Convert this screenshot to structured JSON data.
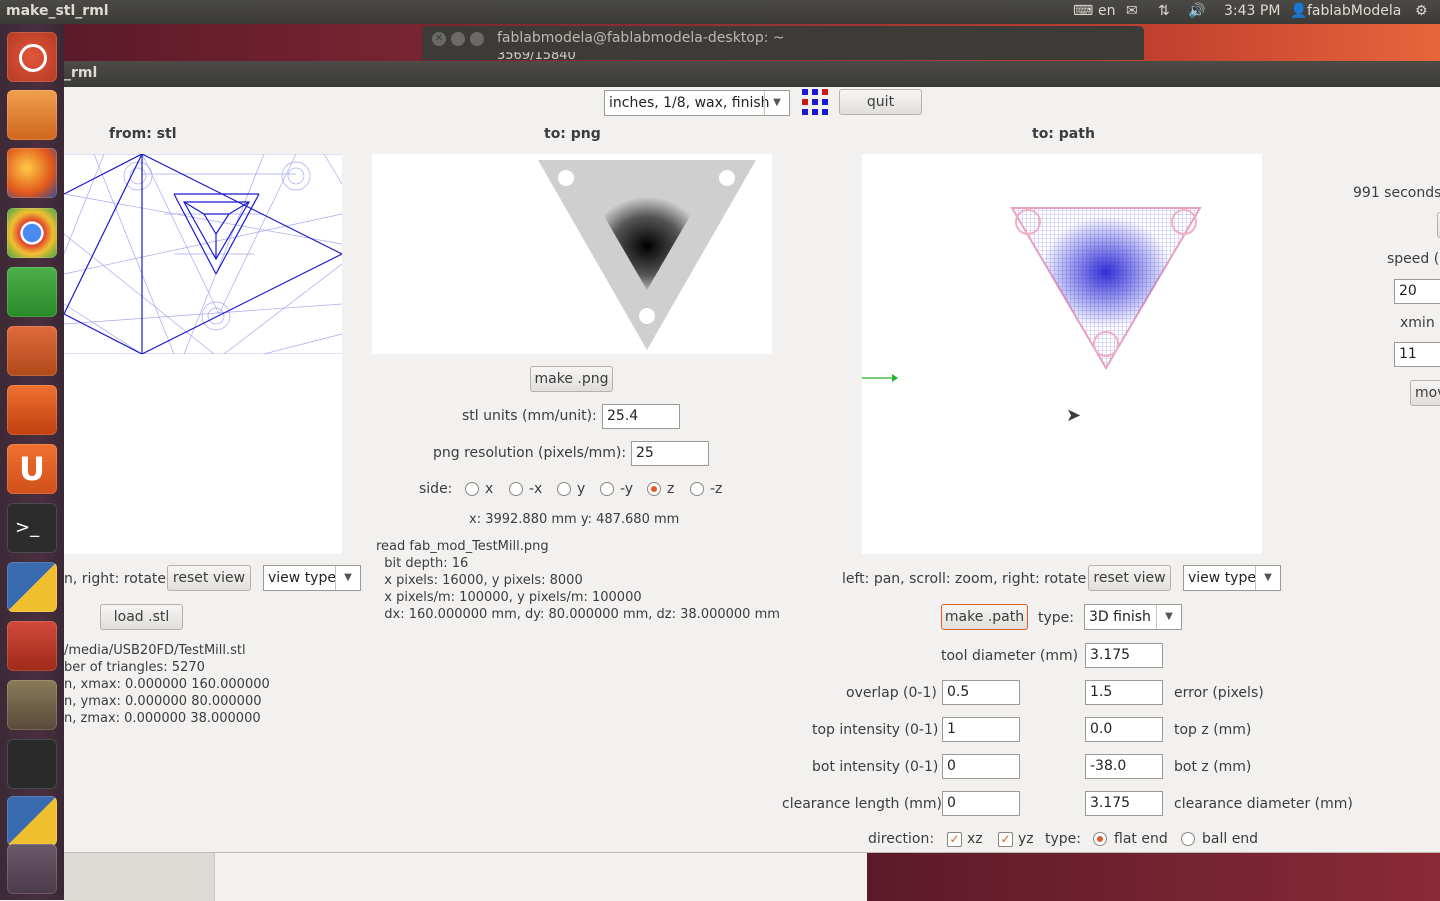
{
  "top_panel": {
    "app_name": "make_stl_rml",
    "keyboard_layout": "en",
    "time": "3:43 PM",
    "user": "fablabModela"
  },
  "terminal_window": {
    "title": "fablabmodela@fablabmodela-desktop: ~",
    "partial_text": "3569/15840"
  },
  "app_window": {
    "title_fragment": "_rml",
    "preset": "inches, 1/8, wax, finish",
    "quit_label": "quit"
  },
  "stl_panel": {
    "header": "from: stl",
    "rotate_hint": "n, right: rotate",
    "reset_view": "reset view",
    "view_type": "view type",
    "load_label": "load .stl",
    "info_lines": [
      "/media/USB20FD/TestMill.stl",
      "ber of triangles: 5270",
      "n, xmax: 0.000000 160.000000",
      "n, ymax: 0.000000 80.000000",
      "n, zmax: 0.000000 38.000000"
    ]
  },
  "png_panel": {
    "header": "to: png",
    "make_label": "make .png",
    "stl_units_label": "stl units (mm/unit):",
    "stl_units_value": "25.4",
    "png_res_label": "png resolution (pixels/mm):",
    "png_res_value": "25",
    "side_label": "side:",
    "sides": [
      {
        "label": "x",
        "selected": false
      },
      {
        "label": "-x",
        "selected": false
      },
      {
        "label": "y",
        "selected": false
      },
      {
        "label": "-y",
        "selected": false
      },
      {
        "label": "z",
        "selected": true
      },
      {
        "label": "-z",
        "selected": false
      }
    ],
    "coords": "x: 3992.880 mm  y: 487.680 mm",
    "info_lines": [
      "read fab_mod_TestMill.png",
      "  bit depth: 16",
      "  x pixels: 16000, y pixels: 8000",
      "  x pixels/m: 100000, y pixels/m: 100000",
      "  dx: 160.000000 mm, dy: 80.000000 mm, dz: 38.000000 mm"
    ]
  },
  "path_panel": {
    "header": "to: path",
    "nav_hint": "left: pan, scroll: zoom, right: rotate",
    "reset_view": "reset view",
    "view_type": "view type",
    "make_label": "make .path",
    "type_label": "type:",
    "type_value": "3D finish",
    "tool_diameter_label": "tool diameter (mm)",
    "tool_diameter_value": "3.175",
    "overlap_label": "overlap (0-1)",
    "overlap_value": "0.5",
    "error_label": "error (pixels)",
    "error_value": "1.5",
    "top_intensity_label": "top intensity (0-1)",
    "top_intensity_value": "1",
    "top_z_label": "top z (mm)",
    "top_z_value": "0.0",
    "bot_intensity_label": "bot intensity (0-1)",
    "bot_intensity_value": "0",
    "bot_z_label": "bot z (mm)",
    "bot_z_value": "-38.0",
    "clearance_length_label": "clearance length (mm)",
    "clearance_length_value": "0",
    "clearance_diameter_label": "clearance diameter (mm)",
    "clearance_diameter_value": "3.175",
    "direction_label": "direction:",
    "dir_xz": "xz",
    "dir_yz": "yz",
    "end_type_label": "type:",
    "flat_end": "flat end",
    "ball_end": "ball end"
  },
  "rml_panel": {
    "time_text": "991 seconds,",
    "speed_label": "speed (",
    "speed_value": "20",
    "xmin_label": "xmin (",
    "xmin_value": "11",
    "move_label": "mov"
  },
  "colors": {
    "accent": "#e05a2a",
    "mesh": "#6a6ae8",
    "panel_bg": "#f2f1f0"
  }
}
